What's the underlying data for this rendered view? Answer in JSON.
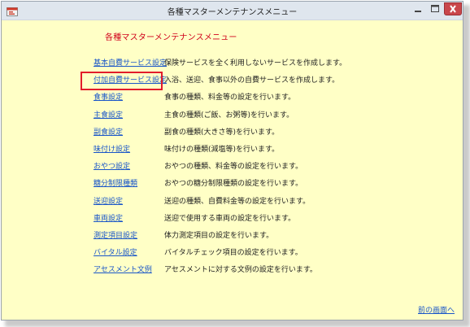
{
  "window": {
    "title": "各種マスターメンテナンスメニュー"
  },
  "heading": "各種マスターメンテナンスメニュー",
  "menu": [
    {
      "link": "基本自費サービス設定",
      "desc": "保険サービスを全く利用しないサービスを作成します。"
    },
    {
      "link": "付加自費サービス設定",
      "desc": "入浴、送迎、食事以外の自費サービスを作成します。"
    },
    {
      "link": "食事設定",
      "desc": "食事の種類、料金等の設定を行います。"
    },
    {
      "link": "主食設定",
      "desc": "主食の種類(ご飯、お粥等)を行います。"
    },
    {
      "link": "副食設定",
      "desc": "副食の種類(大きさ等)を行います。"
    },
    {
      "link": "味付け設定",
      "desc": "味付けの種類(減塩等)を行います。"
    },
    {
      "link": "おやつ設定",
      "desc": "おやつの種類、料金等の設定を行います。"
    },
    {
      "link": "糖分制限種類",
      "desc": "おやつの糖分制限種類の設定を行います。"
    },
    {
      "link": "送迎設定",
      "desc": "送迎の種類、自費料金等の設定を行います。"
    },
    {
      "link": "車両設定",
      "desc": "送迎で使用する車両の設定を行います。"
    },
    {
      "link": "測定項目設定",
      "desc": "体力測定項目の設定を行います。"
    },
    {
      "link": "バイタル設定",
      "desc": "バイタルチェック項目の設定を行います。"
    },
    {
      "link": "アセスメント文例",
      "desc": "アセスメントに対する文例の設定を行います。"
    }
  ],
  "back_link": "前の画面へ",
  "colors": {
    "background": "#ffffc6",
    "link": "#1a56c8",
    "heading": "#d0001a",
    "highlight": "#e21c2b"
  }
}
